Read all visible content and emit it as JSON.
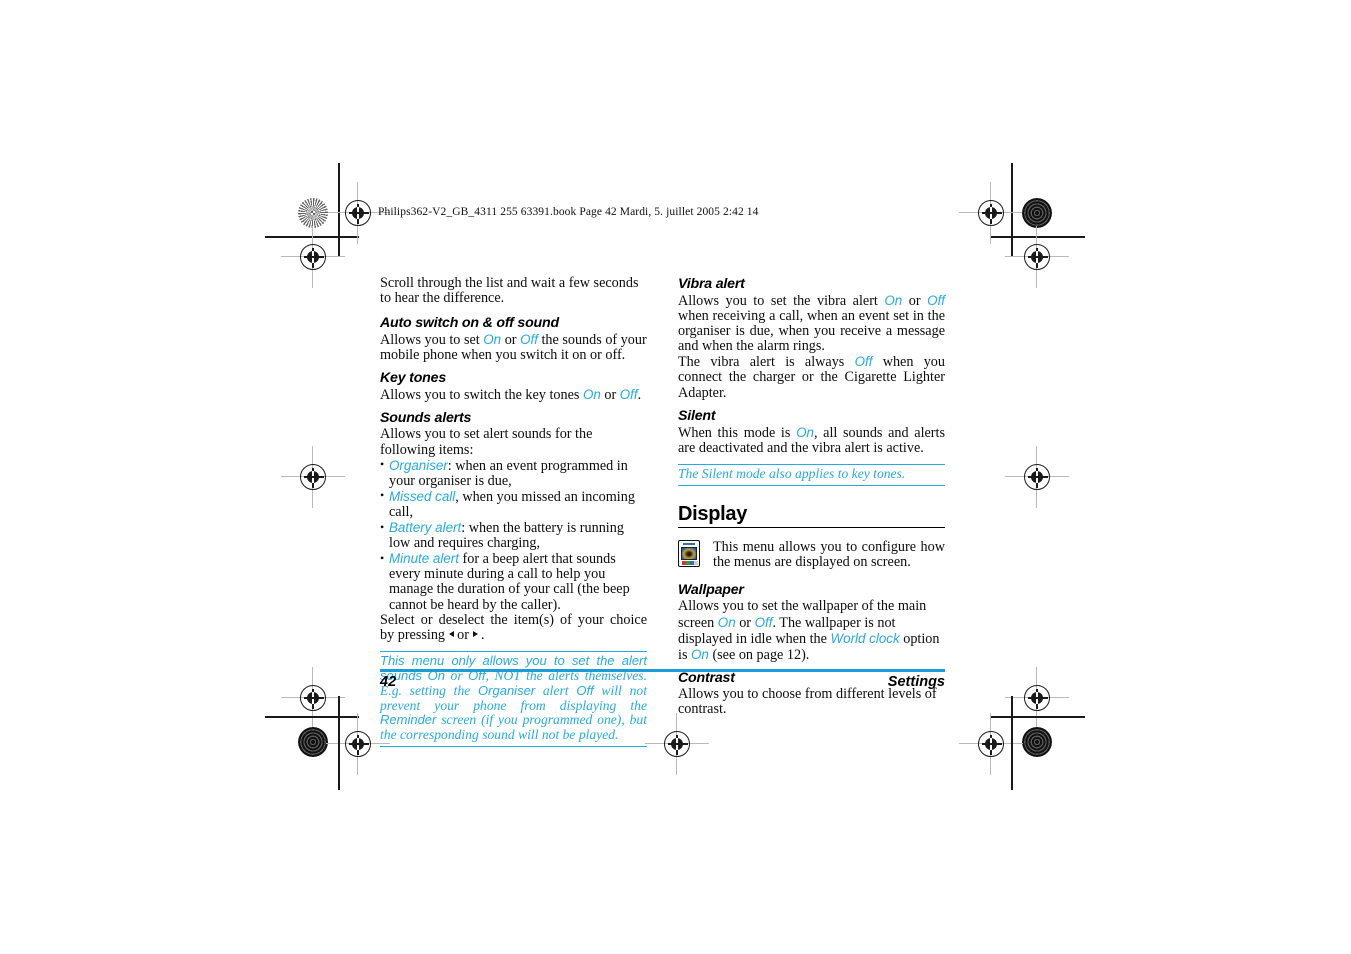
{
  "document": {
    "file_header": "Philips362-V2_GB_4311 255 63391.book  Page 42  Mardi, 5. juillet 2005  2:42 14",
    "accent_color": "#27AAE1",
    "footer_rule_color": "#1B9CD8"
  },
  "footer": {
    "page_number": "42",
    "running_head": "Settings"
  },
  "left_column": {
    "intro": {
      "text": "Scroll through the list and wait a few seconds to hear the difference."
    },
    "auto_switch": {
      "heading": "Auto switch on & off sound",
      "body_1": "Allows you to set ",
      "on": "On",
      "body_2": " or ",
      "off": "Off",
      "body_3": " the sounds of your mobile phone when you switch it on or off."
    },
    "key_tones": {
      "heading": "Key tones",
      "body_1": "Allows you to switch the key tones ",
      "on": "On",
      "body_2": " or ",
      "off": "Off",
      "body_3": "."
    },
    "sounds_alerts": {
      "heading": "Sounds alerts",
      "intro": "Allows you to set alert sounds for the following items:",
      "items": [
        {
          "term": "Organiser",
          "text": ": when an event programmed in your organiser is due,"
        },
        {
          "term": "Missed call",
          "text": ", when you missed an incoming call,"
        },
        {
          "term": "Battery alert",
          "text": ": when the battery is running low and requires charging,"
        },
        {
          "term": "Minute alert",
          "text": " for a beep alert that sounds every minute during a call to help you manage the duration of your call (the beep cannot be heard by the caller)."
        }
      ],
      "select_text_1": "Select or deselect the item(s) of your choice by pressing ",
      "select_or": " or ",
      "select_text_2": " .",
      "left_arrow_icon": "left-triangle-icon",
      "right_arrow_icon": "right-triangle-icon"
    },
    "note": {
      "part_1": "This menu only allows you to set the alert sounds ",
      "on": "On",
      "part_2": " or ",
      "off": "Off",
      "part_3": ", NOT the alerts themselves. E.g. setting the ",
      "organiser": "Organiser",
      "part_4": " alert ",
      "off_2": "Off",
      "part_5": " will not prevent your phone from displaying the ",
      "reminder": "Reminder",
      "part_6": " screen (if you programmed one), but the corresponding sound will not be played."
    }
  },
  "right_column": {
    "vibra_alert": {
      "heading": "Vibra alert",
      "body_1": "Allows you to set the vibra alert ",
      "on": "On",
      "body_2": " or ",
      "off": "Off",
      "body_3": " when receiving a call, when an event set in the organiser is due, when you receive a message and when the alarm rings.",
      "body_4": "The vibra alert is always ",
      "off_2": "Off",
      "body_5": " when you connect the charger or the Cigarette Lighter Adapter."
    },
    "silent": {
      "heading": "Silent",
      "body_1": "When this mode is ",
      "on": "On",
      "body_2": ", all sounds and alerts are deactivated and the vibra alert is active.",
      "note": "The Silent mode also applies to key tones."
    },
    "display": {
      "heading": "Display",
      "icon": "phone-display-icon",
      "intro": "This menu allows you to configure how the menus are displayed on screen."
    },
    "wallpaper": {
      "heading": "Wallpaper",
      "body_1": "Allows you to set the wallpaper of the main screen ",
      "on": "On",
      "body_2": " or ",
      "off": "Off",
      "body_3": ". The wallpaper is not displayed in idle when the ",
      "world_clock": "World clock",
      "body_4": " option is ",
      "on_2": "On",
      "body_5": "  (see on page 12)."
    },
    "contrast": {
      "heading": "Contrast",
      "body": "Allows you to choose from different levels of contrast."
    }
  }
}
